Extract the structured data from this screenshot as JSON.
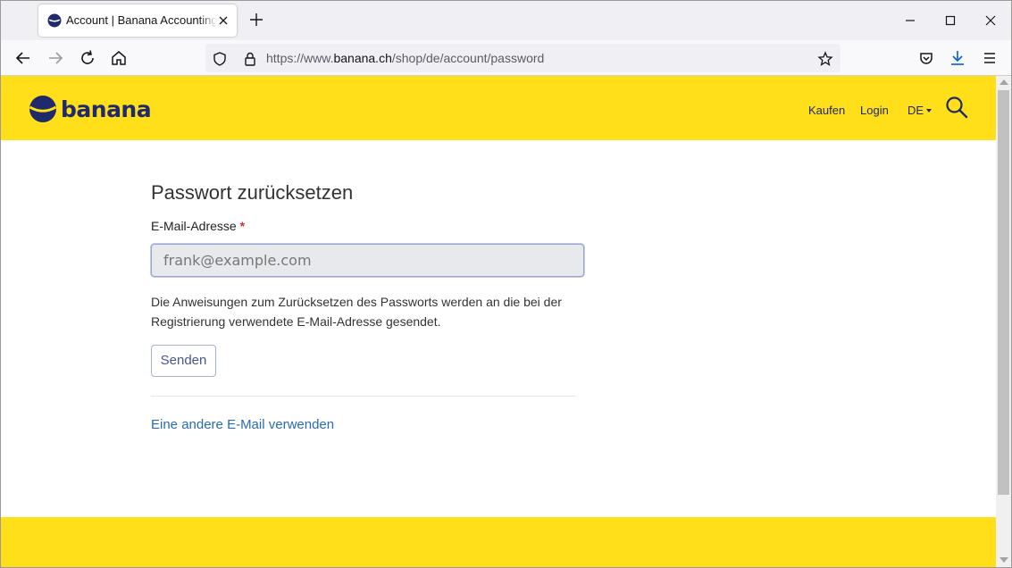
{
  "browser": {
    "tab_title": "Account | Banana Accounting S",
    "new_tab_icon": "plus-icon",
    "url_scheme": "https://www.",
    "url_host": "banana.ch",
    "url_path": "/shop/de/account/password"
  },
  "site": {
    "logo_text": "banana",
    "nav": {
      "kaufen": "Kaufen",
      "login": "Login",
      "language": "DE"
    },
    "brand_color": "#ffde1a",
    "brand_dark": "#1f2a6b"
  },
  "form": {
    "title": "Passwort zurücksetzen",
    "email_label": "E-Mail-Adresse",
    "required_marker": "*",
    "email_value": "frank@example.com",
    "help_text": "Die Anweisungen zum Zurücksetzen des Passworts werden an die bei der Registrierung verwendete E-Mail-Adresse gesendet.",
    "send_label": "Senden",
    "other_email_link": "Eine andere E-Mail verwenden"
  }
}
